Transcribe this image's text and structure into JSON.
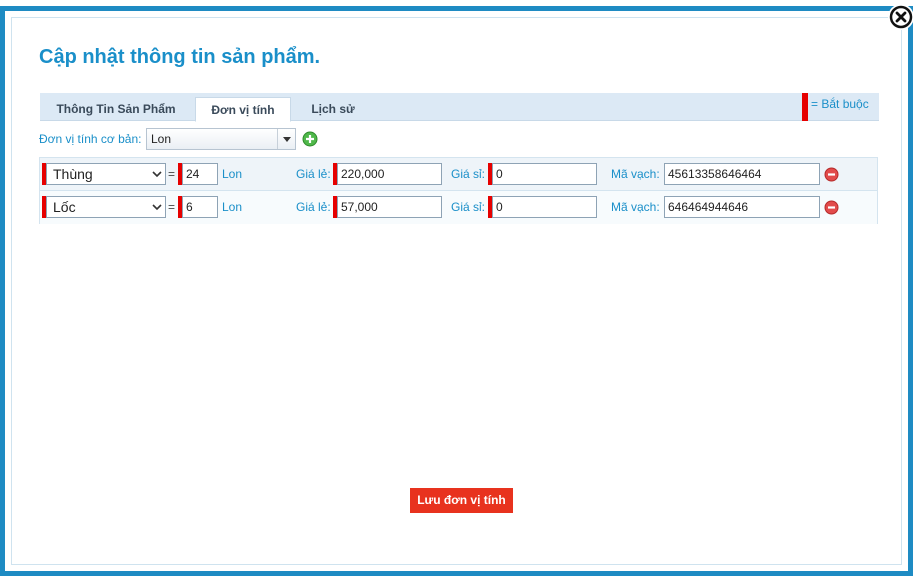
{
  "dialog": {
    "title": "Cập nhật thông tin sản phẩm."
  },
  "tabs": [
    {
      "label": "Thông Tin Sản Phẩm",
      "active": false
    },
    {
      "label": "Đơn vị tính",
      "active": true
    },
    {
      "label": "Lịch sử",
      "active": false
    }
  ],
  "legend": {
    "required_text": "= Bắt buộc",
    "required_color": "#e60000"
  },
  "base_unit": {
    "label": "Đơn vị tính cơ bản:",
    "value": "Lon"
  },
  "unit_rows": [
    {
      "unit": "Thùng",
      "equals": "=",
      "quantity": "24",
      "base_unit": "Lon",
      "retail_label": "Giá lẻ:",
      "retail_price": "220,000",
      "wholesale_label": "Giá sỉ:",
      "wholesale_price": "0",
      "barcode_label": "Mã vạch:",
      "barcode": "45613358646464"
    },
    {
      "unit": "Lốc",
      "equals": "=",
      "quantity": "6",
      "base_unit": "Lon",
      "retail_label": "Giá lẻ:",
      "retail_price": "57,000",
      "wholesale_label": "Giá sỉ:",
      "wholesale_price": "0",
      "barcode_label": "Mã vạch:",
      "barcode": "646464944646"
    }
  ],
  "actions": {
    "save_label": "Lưu đơn vị tính"
  },
  "colors": {
    "accent": "#1a8fc9",
    "border": "#1e8bc3",
    "save_button": "#e8321e"
  }
}
